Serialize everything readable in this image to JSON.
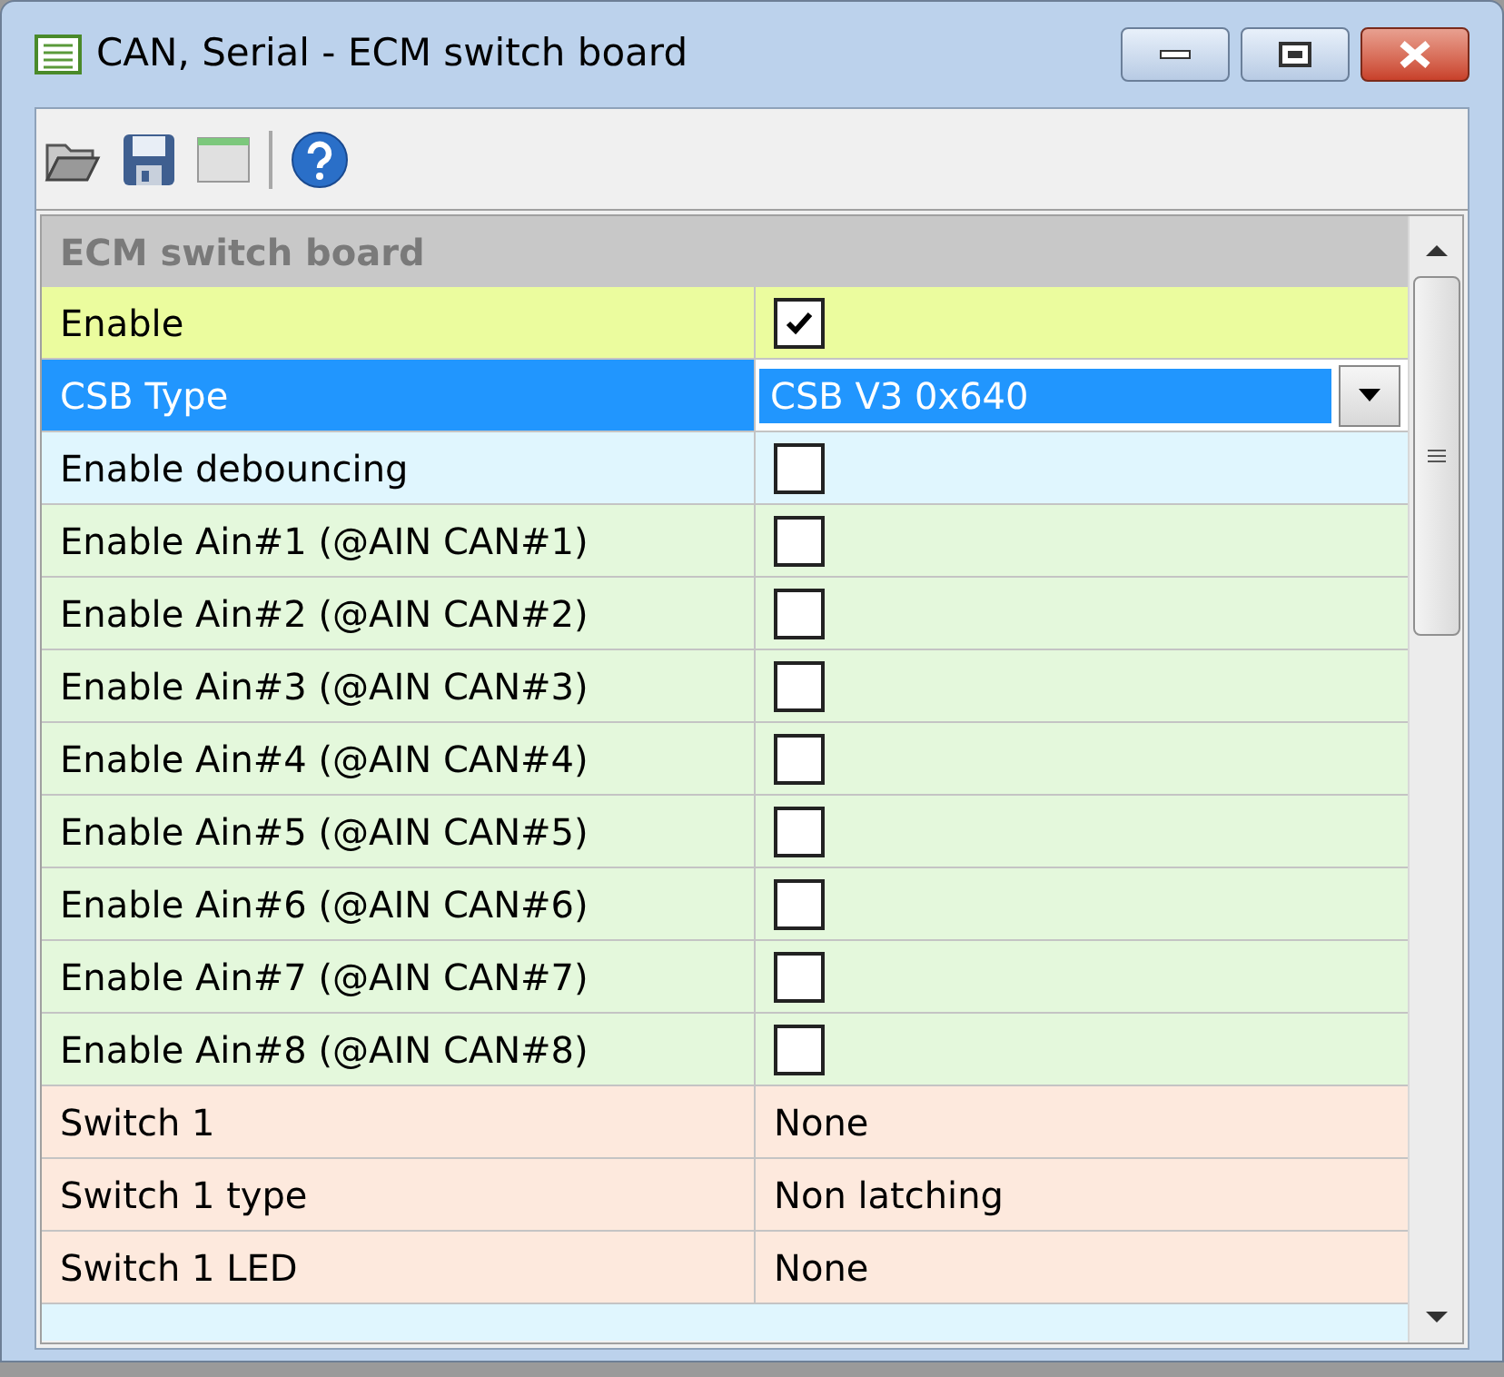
{
  "window": {
    "title": "CAN, Serial - ECM switch board"
  },
  "grid": {
    "category": "ECM switch board",
    "rows": [
      {
        "label": "Enable",
        "kind": "checkbox",
        "checked": true,
        "selected": false,
        "color": "#ebfc9e"
      },
      {
        "label": "CSB Type",
        "kind": "dropdown",
        "value": "CSB V3 0x640",
        "selected": true
      },
      {
        "label": "Enable debouncing",
        "kind": "checkbox",
        "checked": false,
        "selected": false,
        "color": "#e0f6fe"
      },
      {
        "label": "Enable Ain#1 (@AIN CAN#1)",
        "kind": "checkbox",
        "checked": false,
        "selected": false,
        "color": "#e4f8dc"
      },
      {
        "label": "Enable Ain#2 (@AIN CAN#2)",
        "kind": "checkbox",
        "checked": false,
        "selected": false,
        "color": "#e4f8dc"
      },
      {
        "label": "Enable Ain#3 (@AIN CAN#3)",
        "kind": "checkbox",
        "checked": false,
        "selected": false,
        "color": "#e4f8dc"
      },
      {
        "label": "Enable Ain#4 (@AIN CAN#4)",
        "kind": "checkbox",
        "checked": false,
        "selected": false,
        "color": "#e4f8dc"
      },
      {
        "label": "Enable Ain#5 (@AIN CAN#5)",
        "kind": "checkbox",
        "checked": false,
        "selected": false,
        "color": "#e4f8dc"
      },
      {
        "label": "Enable Ain#6 (@AIN CAN#6)",
        "kind": "checkbox",
        "checked": false,
        "selected": false,
        "color": "#e4f8dc"
      },
      {
        "label": "Enable Ain#7 (@AIN CAN#7)",
        "kind": "checkbox",
        "checked": false,
        "selected": false,
        "color": "#e4f8dc"
      },
      {
        "label": "Enable Ain#8 (@AIN CAN#8)",
        "kind": "checkbox",
        "checked": false,
        "selected": false,
        "color": "#e4f8dc"
      },
      {
        "label": "Switch 1",
        "kind": "text",
        "value": "None",
        "selected": false,
        "color": "#fde9dd"
      },
      {
        "label": "Switch 1 type",
        "kind": "text",
        "value": "Non latching",
        "selected": false,
        "color": "#fde9dd"
      },
      {
        "label": "Switch 1 LED",
        "kind": "text",
        "value": "None",
        "selected": false,
        "color": "#fde9dd"
      }
    ]
  }
}
